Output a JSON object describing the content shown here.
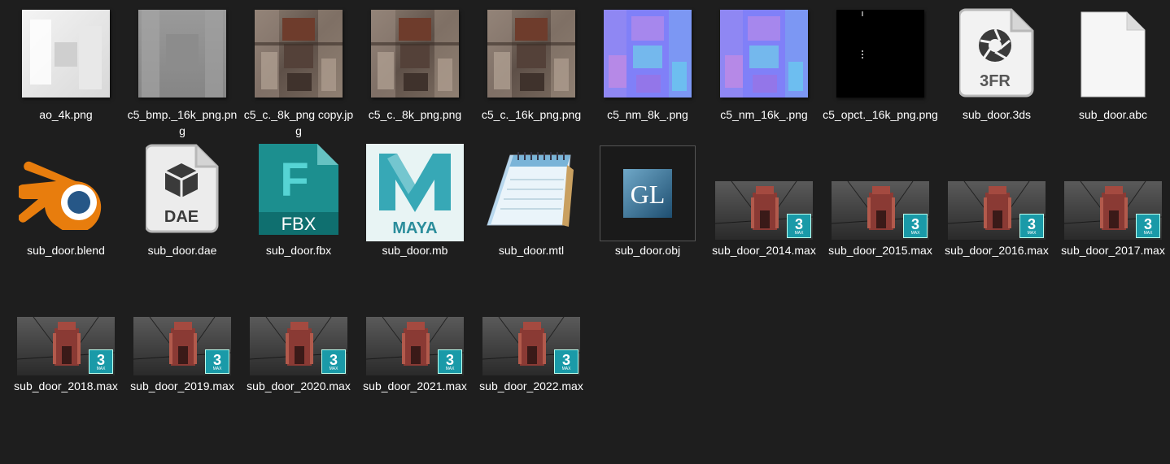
{
  "window": {
    "view": "Large icons"
  },
  "colors": {
    "background": "#1e1e1e",
    "text": "#ffffff",
    "max_teal": "#1a9aa8",
    "blender_orange": "#e87d0d",
    "blender_blue": "#265787",
    "fbx_teal": "#1c8f8f",
    "maya_teal": "#37a8b6"
  },
  "files": [
    {
      "name": "ao_4k.png",
      "icon": "ao-texture-thumbnail-icon",
      "kind": "ao"
    },
    {
      "name": "c5_bmp._16k_png.png",
      "icon": "bump-texture-thumbnail-icon",
      "kind": "bmp"
    },
    {
      "name": "c5_c._8k_png copy.jpg",
      "icon": "color-texture-thumbnail-icon",
      "kind": "color"
    },
    {
      "name": "c5_c._8k_png.png",
      "icon": "color-texture-thumbnail-icon",
      "kind": "color"
    },
    {
      "name": "c5_c._16k_png.png",
      "icon": "color-texture-thumbnail-icon",
      "kind": "color"
    },
    {
      "name": "c5_nm_8k_.png",
      "icon": "normal-map-thumbnail-icon",
      "kind": "normal"
    },
    {
      "name": "c5_nm_16k_.png",
      "icon": "normal-map-thumbnail-icon",
      "kind": "normal"
    },
    {
      "name": "c5_opct._16k_png.png",
      "icon": "opacity-map-thumbnail-icon",
      "kind": "opacity"
    },
    {
      "name": "sub_door.3ds",
      "icon": "camera-aperture-file-icon",
      "kind": "3fr",
      "badge": "3FR"
    },
    {
      "name": "sub_door.abc",
      "icon": "blank-file-icon",
      "kind": "blank"
    },
    {
      "name": "sub_door.blend",
      "icon": "blender-logo-icon",
      "kind": "blend"
    },
    {
      "name": "sub_door.dae",
      "icon": "cube-file-icon",
      "kind": "dae",
      "badge": "DAE"
    },
    {
      "name": "sub_door.fbx",
      "icon": "fbx-file-icon",
      "kind": "fbx",
      "badge": "FBX",
      "letter": "F"
    },
    {
      "name": "sub_door.mb",
      "icon": "maya-logo-icon",
      "kind": "maya",
      "badge": "MAYA",
      "letter": "M"
    },
    {
      "name": "sub_door.mtl",
      "icon": "notepad-icon",
      "kind": "mtl"
    },
    {
      "name": "sub_door.obj",
      "icon": "gl-logo-icon",
      "kind": "obj",
      "badge": "GL"
    },
    {
      "name": "sub_door_2014.max",
      "icon": "3dsmax-render-thumbnail-icon",
      "kind": "max",
      "badge": "3"
    },
    {
      "name": "sub_door_2015.max",
      "icon": "3dsmax-render-thumbnail-icon",
      "kind": "max",
      "badge": "3"
    },
    {
      "name": "sub_door_2016.max",
      "icon": "3dsmax-render-thumbnail-icon",
      "kind": "max",
      "badge": "3"
    },
    {
      "name": "sub_door_2017.max",
      "icon": "3dsmax-render-thumbnail-icon",
      "kind": "max",
      "badge": "3"
    },
    {
      "name": "sub_door_2018.max",
      "icon": "3dsmax-render-thumbnail-icon",
      "kind": "max",
      "badge": "3"
    },
    {
      "name": "sub_door_2019.max",
      "icon": "3dsmax-render-thumbnail-icon",
      "kind": "max",
      "badge": "3"
    },
    {
      "name": "sub_door_2020.max",
      "icon": "3dsmax-render-thumbnail-icon",
      "kind": "max",
      "badge": "3"
    },
    {
      "name": "sub_door_2021.max",
      "icon": "3dsmax-render-thumbnail-icon",
      "kind": "max",
      "badge": "3"
    },
    {
      "name": "sub_door_2022.max",
      "icon": "3dsmax-render-thumbnail-icon",
      "kind": "max",
      "badge": "3"
    }
  ]
}
